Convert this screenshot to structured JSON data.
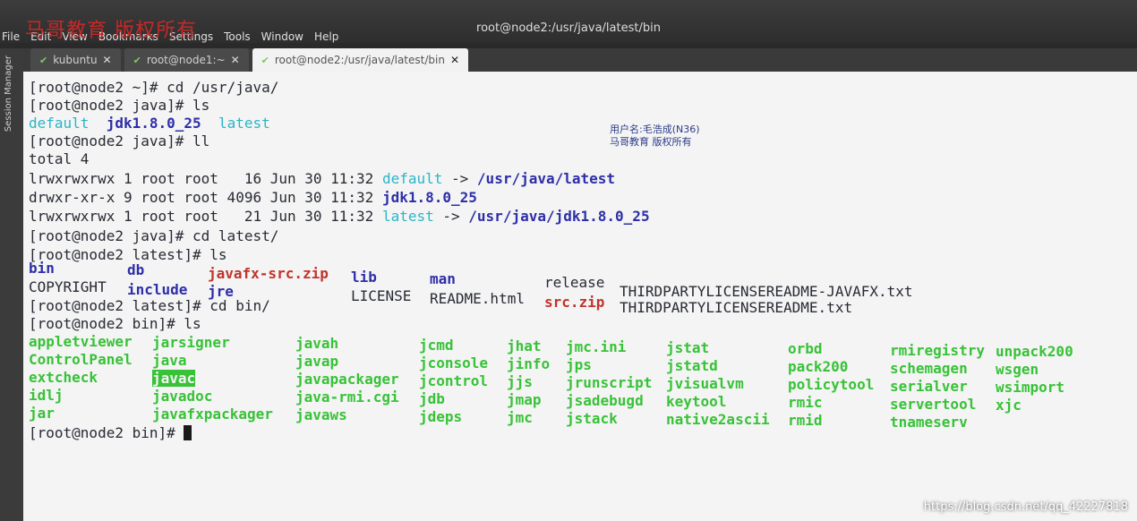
{
  "window": {
    "title": "root@node2:/usr/java/latest/bin"
  },
  "menu": [
    "File",
    "Edit",
    "View",
    "Bookmarks",
    "Settings",
    "Tools",
    "Window",
    "Help"
  ],
  "watermark_top": "马哥教育 版权所有",
  "tabs": [
    {
      "label": "kubuntu",
      "active": false
    },
    {
      "label": "root@node1:~",
      "active": false
    },
    {
      "label": "root@node2:/usr/java/latest/bin",
      "active": true
    }
  ],
  "session_manager_label": "Session Manager",
  "watermark_user": [
    "用户名:毛浩成(N36)",
    "马哥教育 版权所有"
  ],
  "terminal": {
    "lines": [
      "[root@node2 ~]# cd /usr/java/",
      "[root@node2 java]# ls",
      "[root@node2 java]# ll",
      "total 4",
      "lrwxrwxrwx 1 root root   16 Jun 30 11:32 ",
      "drwxr-xr-x 9 root root 4096 Jun 30 11:32 ",
      "lrwxrwxrwx 1 root root   21 Jun 30 11:32 ",
      "[root@node2 java]# cd latest/",
      "[root@node2 latest]# ls",
      "[root@node2 latest]# cd bin/",
      "[root@node2 bin]# ls",
      "[root@node2 bin]# "
    ],
    "java_ls": [
      "default",
      "jdk1.8.0_25",
      "latest"
    ],
    "ll_targets": [
      {
        "name": "default",
        "arrow": " -> ",
        "target": "/usr/java/latest"
      },
      {
        "name": "jdk1.8.0_25"
      },
      {
        "name": "latest",
        "arrow": " -> ",
        "target": "/usr/java/jdk1.8.0_25"
      }
    ],
    "latest_ls_row1": [
      "bin",
      "db",
      "javafx-src.zip",
      "lib",
      "man",
      "release",
      "THIRDPARTYLICENSEREADME-JAVAFX.txt"
    ],
    "latest_ls_row2": [
      "COPYRIGHT",
      "include",
      "jre",
      "LICENSE",
      "README.html",
      "src.zip",
      "THIRDPARTYLICENSEREADME.txt"
    ],
    "bin_columns": [
      [
        "appletviewer",
        "ControlPanel",
        "extcheck",
        "idlj",
        "jar"
      ],
      [
        "jarsigner",
        "java",
        "javac",
        "javadoc",
        "javafxpackager"
      ],
      [
        "javah",
        "javap",
        "javapackager",
        "java-rmi.cgi",
        "javaws"
      ],
      [
        "jcmd",
        "jconsole",
        "jcontrol",
        "jdb",
        "jdeps"
      ],
      [
        "jhat",
        "jinfo",
        "jjs",
        "jmap",
        "jmc"
      ],
      [
        "jmc.ini",
        "jps",
        "jrunscript",
        "jsadebugd",
        "jstack"
      ],
      [
        "jstat",
        "jstatd",
        "jvisualvm",
        "keytool",
        "native2ascii"
      ],
      [
        "orbd",
        "pack200",
        "policytool",
        "rmic",
        "rmid"
      ],
      [
        "rmiregistry",
        "schemagen",
        "serialver",
        "servertool",
        "tnameserv"
      ],
      [
        "unpack200",
        "wsgen",
        "wsimport",
        "xjc"
      ]
    ],
    "selected_entry": "javac"
  },
  "csdn_watermark": "https://blog.csdn.net/qq_42227818",
  "colors": {
    "cyan": "#2bb5c8",
    "blue": "#2e2ea8",
    "red": "#c2332c",
    "green": "#38c238",
    "bg": "#f3f4f3"
  }
}
